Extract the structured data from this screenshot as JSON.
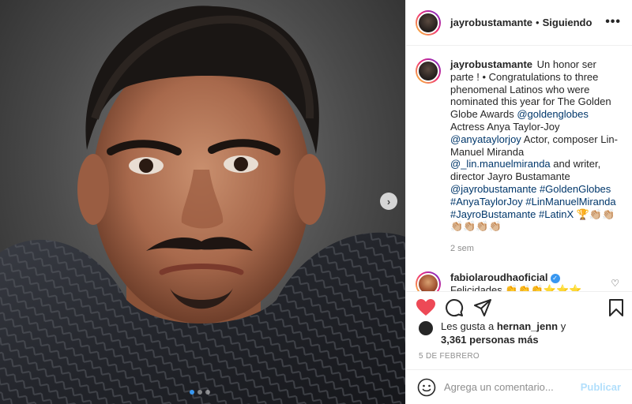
{
  "post": {
    "username": "jayrobustamante",
    "separator": "•",
    "follow_status": "Siguiendo",
    "caption": {
      "username": "jayrobustamante",
      "parts": [
        {
          "type": "text",
          "value": " Un honor ser parte ! • Congratulations to three phenomenal Latinos who were nominated this year for The Golden Globe Awards "
        },
        {
          "type": "link",
          "value": "@goldenglobes"
        },
        {
          "type": "text",
          "value": " Actress Anya Taylor-Joy "
        },
        {
          "type": "link",
          "value": "@anyataylorjoy"
        },
        {
          "type": "text",
          "value": " Actor, composer Lin-Manuel Miranda "
        },
        {
          "type": "link",
          "value": "@_lin.manuelmiranda"
        },
        {
          "type": "text",
          "value": " and writer, director Jayro Bustamante "
        },
        {
          "type": "link",
          "value": "@jayrobustamante"
        },
        {
          "type": "text",
          "value": " "
        },
        {
          "type": "link",
          "value": "#GoldenGlobes"
        },
        {
          "type": "text",
          "value": " "
        },
        {
          "type": "link",
          "value": "#AnyaTaylorJoy"
        },
        {
          "type": "text",
          "value": " "
        },
        {
          "type": "link",
          "value": "#LinManuelMiranda"
        },
        {
          "type": "text",
          "value": " "
        },
        {
          "type": "link",
          "value": "#JayroBustamante"
        },
        {
          "type": "text",
          "value": " "
        },
        {
          "type": "link",
          "value": "#LatinX"
        },
        {
          "type": "text",
          "value": " 🏆👏🏼👏🏼👏🏼👏🏼👏🏼👏🏼"
        }
      ]
    },
    "caption_time": "2 sem",
    "comment": {
      "username": "fabiolaroudhaoficial",
      "verified_mark": "✓",
      "text": "Felicidades 👏👏👏⭐⭐⭐",
      "like_icon": "♡"
    },
    "likes": {
      "prefix": "Les gusta a ",
      "user": "hernan_jenn",
      "joiner": " y",
      "count": "3,361 personas más"
    },
    "date": "5 DE FEBRERO",
    "add_comment": {
      "placeholder": "Agrega un comentario...",
      "publish_label": "Publicar"
    },
    "more_icon": "•••",
    "next_icon": "›",
    "colors": {
      "like_red": "#ed4956",
      "link_blue": "#00376b",
      "publish_blue": "#b2dffc",
      "verified_blue": "#3897f0"
    },
    "carousel_dots": 3,
    "carousel_active": 0
  }
}
